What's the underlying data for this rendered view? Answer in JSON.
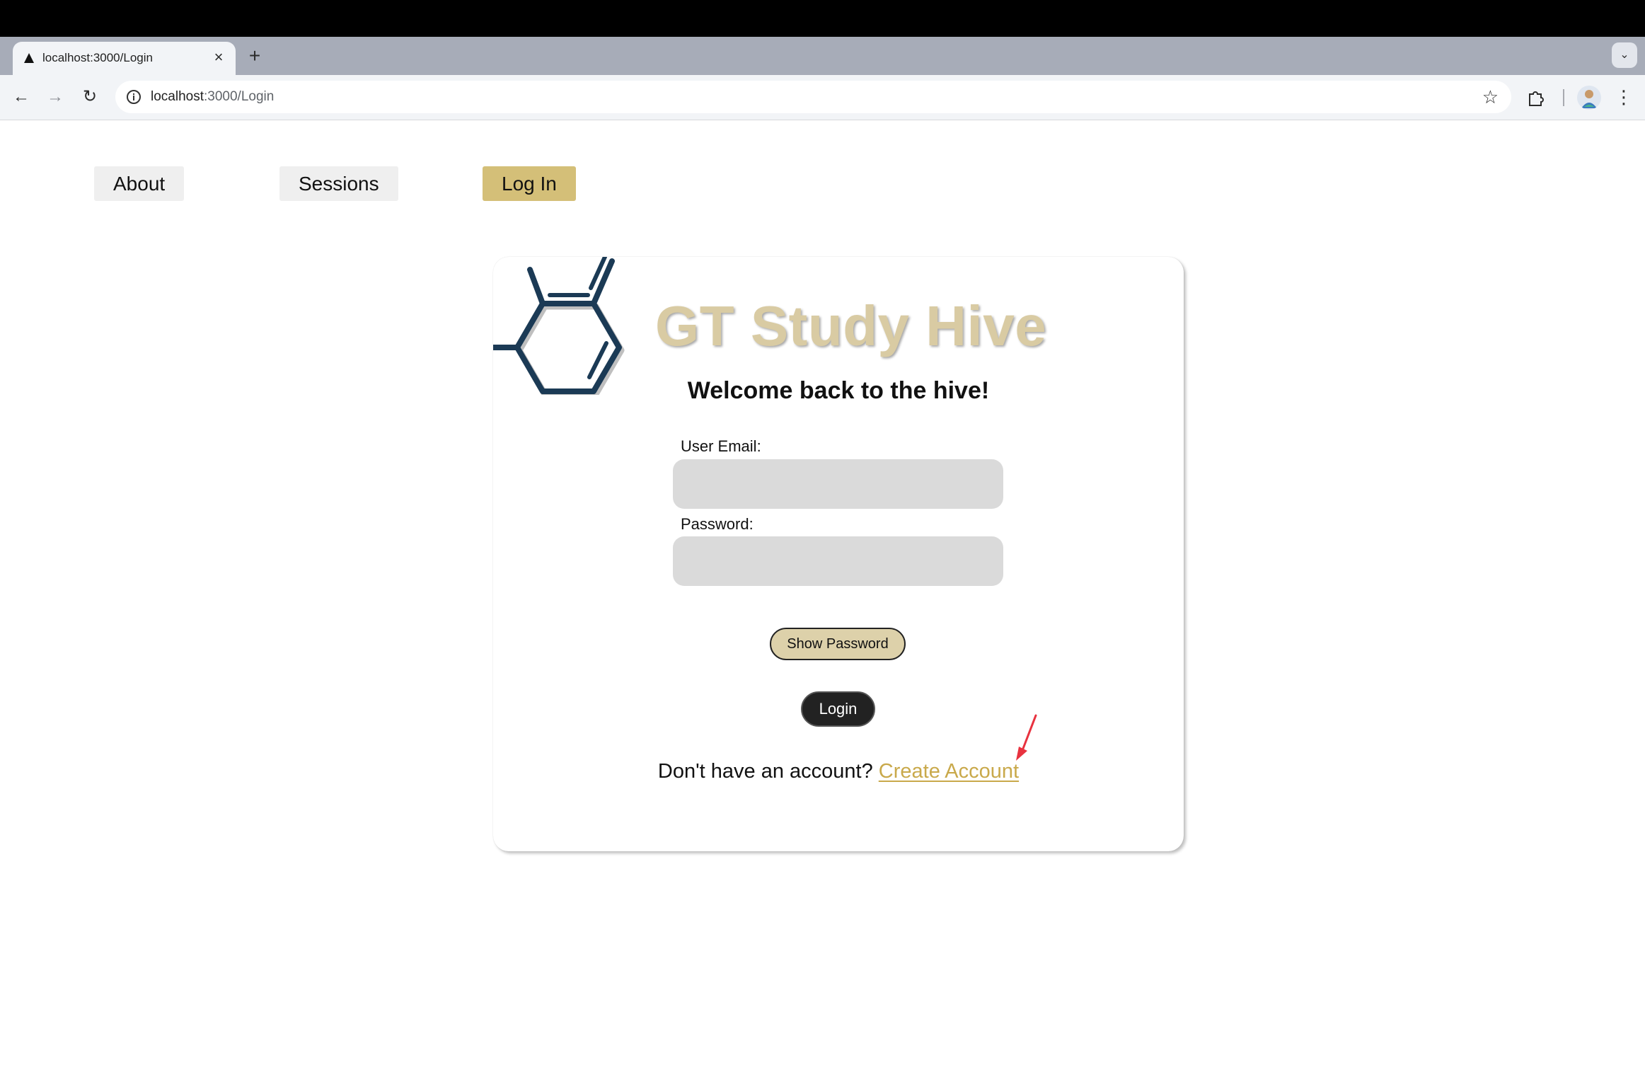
{
  "browser": {
    "tab_title": "localhost:3000/Login",
    "url_host": "localhost",
    "url_path": ":3000/Login",
    "icons": {
      "back": "arrow-left-icon",
      "forward": "arrow-right-icon",
      "reload": "reload-icon",
      "info": "info-icon",
      "bookmark": "star-icon",
      "extensions": "puzzle-icon",
      "menu": "kebab-menu-icon",
      "tab_search": "chevron-down-icon",
      "new_tab": "plus-icon",
      "close_tab": "close-icon"
    }
  },
  "nav": {
    "about": "About",
    "sessions": "Sessions",
    "login": "Log In",
    "active": "Log In",
    "active_color": "#d4bf78"
  },
  "card": {
    "title": "GT Study Hive",
    "title_color": "#d9cba3",
    "welcome": "Welcome back to the hive!",
    "email_label": "User Email:",
    "email_value": "",
    "password_label": "Password:",
    "password_value": "",
    "show_password": "Show Password",
    "login": "Login",
    "signup_prompt": "Don't have an account?",
    "signup_link": "Create Account",
    "link_color": "#c9a94b"
  }
}
